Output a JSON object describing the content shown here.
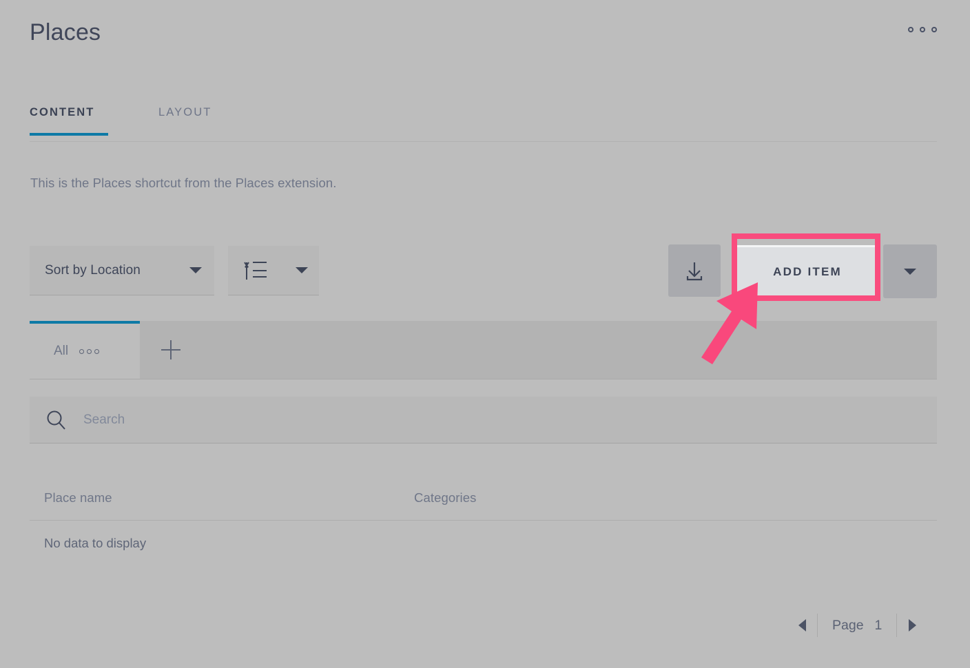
{
  "header": {
    "title": "Places",
    "overflow_icon": "ellipsis-icon"
  },
  "main_tabs": [
    {
      "label": "CONTENT",
      "active": true
    },
    {
      "label": "LAYOUT",
      "active": false
    }
  ],
  "description": "This is the Places shortcut from the Places extension.",
  "toolbar": {
    "sort_by": {
      "value": "Sort by Location",
      "caret_icon": "chevron-down-icon"
    },
    "sort_direction": {
      "icon": "sort-ascending-icon",
      "caret_icon": "chevron-down-icon"
    },
    "import_button": {
      "icon": "download-icon"
    },
    "add_item_button": {
      "label": "ADD ITEM"
    },
    "add_item_dropdown": {
      "caret_icon": "chevron-down-icon"
    }
  },
  "annotation": {
    "highlight_target": "ADD ITEM",
    "highlight_color": "#f94c7e",
    "arrow_icon": "pointer-arrow-icon"
  },
  "filter_tabs": {
    "all_tab": {
      "label": "All",
      "menu_icon": "ellipsis-icon"
    },
    "add_tab": {
      "icon": "plus-icon"
    }
  },
  "search": {
    "icon": "search-icon",
    "value": "",
    "placeholder": "Search"
  },
  "table": {
    "columns": [
      "Place name",
      "Categories"
    ],
    "rows": [],
    "empty_message": "No data to display"
  },
  "pagination": {
    "prev_icon": "triangle-left-icon",
    "next_icon": "triangle-right-icon",
    "page_label": "Page",
    "page_number": "1"
  },
  "colors": {
    "page_background": "#bdbdbd",
    "accent": "#0e7aa6",
    "text_primary": "#3d4456",
    "text_muted": "#6f7688",
    "highlight": "#f94c7e",
    "button_face": "#dddfe2"
  }
}
